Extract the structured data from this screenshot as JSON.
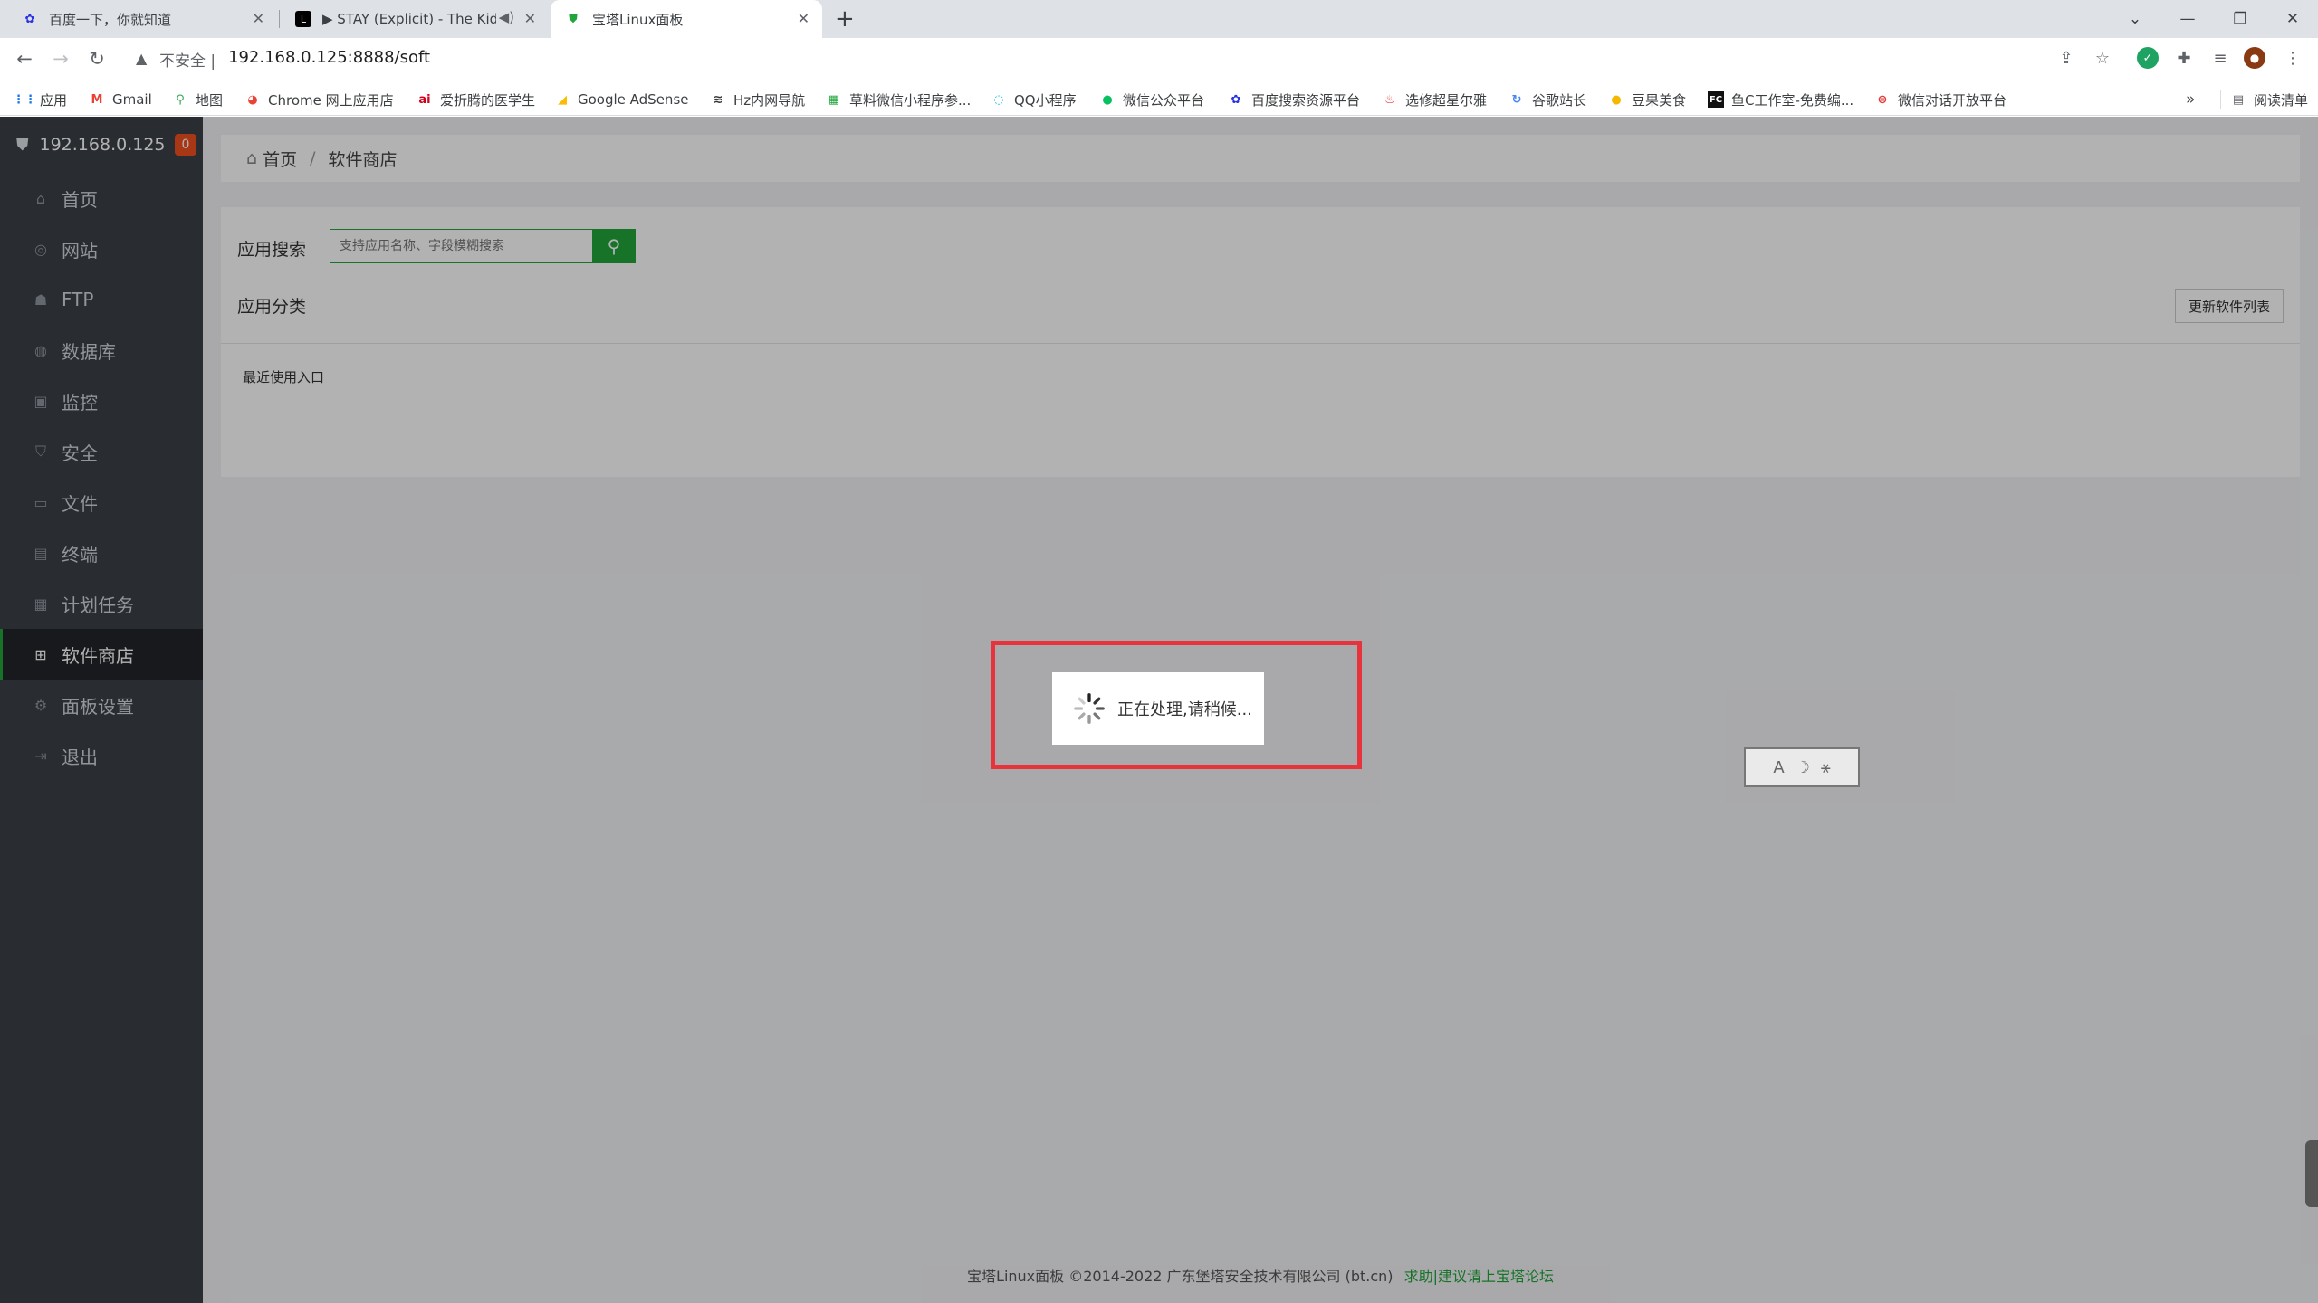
{
  "browser": {
    "tabs": [
      {
        "title": "百度一下，你就知道",
        "icon": "baidu-paw-icon"
      },
      {
        "title": "▶ STAY (Explicit) - The Kid",
        "icon": "music-icon"
      },
      {
        "title": "宝塔Linux面板",
        "icon": "bt-shield-icon"
      }
    ],
    "address": {
      "security_label": "不安全",
      "separator": "|",
      "url": "192.168.0.125:8888/soft"
    },
    "bookmarks": [
      {
        "label": "应用",
        "icon": "apps-grid-icon"
      },
      {
        "label": "Gmail",
        "icon": "gmail-icon"
      },
      {
        "label": "地图",
        "icon": "maps-pin-icon"
      },
      {
        "label": "Chrome 网上应用店",
        "icon": "chrome-store-icon"
      },
      {
        "label": "爱折腾的医学生",
        "icon": "ai-icon"
      },
      {
        "label": "Google AdSense",
        "icon": "adsense-icon"
      },
      {
        "label": "Hz内网导航",
        "icon": "stack-icon"
      },
      {
        "label": "草料微信小程序参...",
        "icon": "qr-grid-icon"
      },
      {
        "label": "QQ小程序",
        "icon": "qq-icon"
      },
      {
        "label": "微信公众平台",
        "icon": "wechat-icon"
      },
      {
        "label": "百度搜索资源平台",
        "icon": "baidu-paw-icon"
      },
      {
        "label": "选修超星尔雅",
        "icon": "chaoxing-icon"
      },
      {
        "label": "谷歌站长",
        "icon": "google-icon"
      },
      {
        "label": "豆果美食",
        "icon": "douguo-icon"
      },
      {
        "label": "鱼C工作室-免费编...",
        "icon": "fishc-icon"
      },
      {
        "label": "微信对话开放平台",
        "icon": "chat-icon"
      }
    ],
    "overflow": "»",
    "reading_list": "阅读清单"
  },
  "sidebar": {
    "server": "192.168.0.125",
    "badge": "0",
    "items": [
      {
        "label": "首页",
        "icon": "home-icon"
      },
      {
        "label": "网站",
        "icon": "globe-icon"
      },
      {
        "label": "FTP",
        "icon": "ftp-icon"
      },
      {
        "label": "数据库",
        "icon": "database-icon"
      },
      {
        "label": "监控",
        "icon": "monitor-icon"
      },
      {
        "label": "安全",
        "icon": "shield-icon"
      },
      {
        "label": "文件",
        "icon": "folder-icon"
      },
      {
        "label": "终端",
        "icon": "terminal-icon"
      },
      {
        "label": "计划任务",
        "icon": "calendar-icon"
      },
      {
        "label": "软件商店",
        "icon": "apps-icon",
        "active": true
      },
      {
        "label": "面板设置",
        "icon": "gear-icon"
      },
      {
        "label": "退出",
        "icon": "logout-icon"
      }
    ]
  },
  "breadcrumb": {
    "home": "首页",
    "current": "软件商店",
    "sep": "/"
  },
  "store": {
    "search_label": "应用搜索",
    "search_placeholder": "支持应用名称、字段模糊搜索",
    "category_label": "应用分类",
    "update_button": "更新软件列表",
    "recent_label": "最近使用入口"
  },
  "loading": {
    "text": "正在处理,请稍候..."
  },
  "widget": {
    "a": "A",
    "b": "☽",
    "c": "⚹"
  },
  "footer": {
    "copyright": "宝塔Linux面板 ©2014-2022 广东堡塔安全技术有限公司 (bt.cn)",
    "link": "求助|建议请上宝塔论坛"
  },
  "colors": {
    "accent": "#20a53a",
    "sidebar": "#3b4047",
    "highlight": "#e8323c",
    "badge": "#f0501f"
  }
}
